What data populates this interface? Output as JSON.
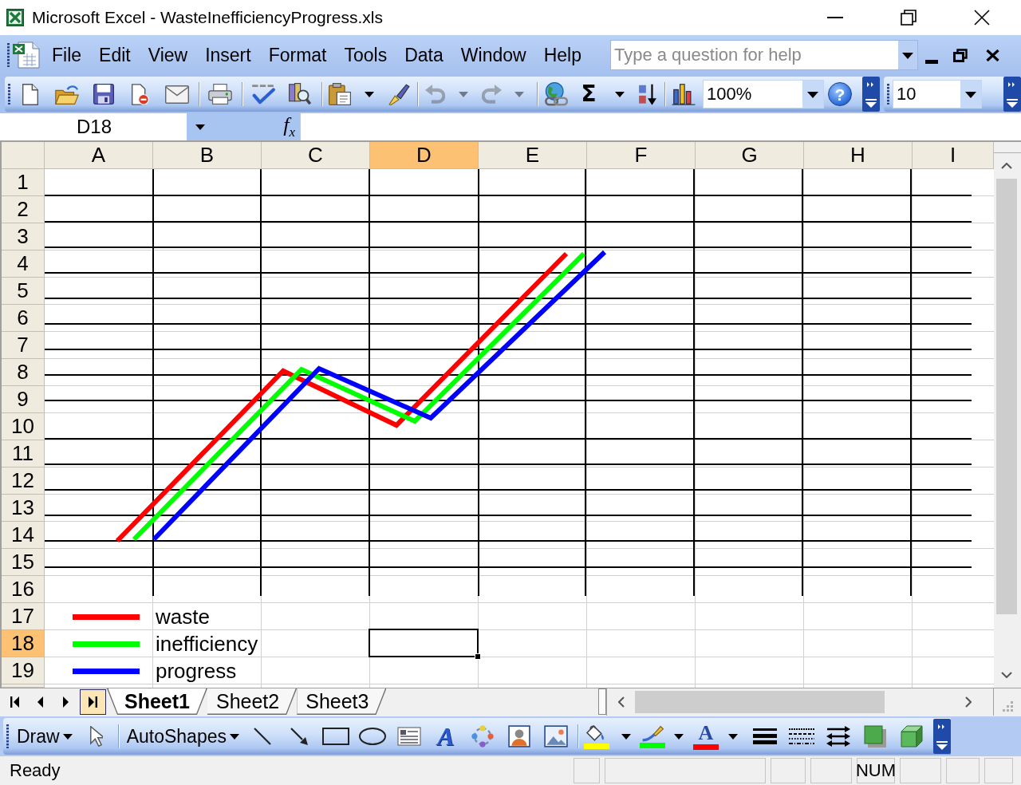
{
  "window": {
    "title": "Microsoft Excel - WasteInefficiencyProgress.xls"
  },
  "menu_bar": {
    "items": [
      {
        "label": "File"
      },
      {
        "label": "Edit"
      },
      {
        "label": "View"
      },
      {
        "label": "Insert"
      },
      {
        "label": "Format"
      },
      {
        "label": "Tools"
      },
      {
        "label": "Data"
      },
      {
        "label": "Window"
      },
      {
        "label": "Help"
      }
    ],
    "help_search": {
      "placeholder": "Type a question for help"
    }
  },
  "standard_toolbar": {
    "groups": [
      [
        {
          "kind": "new",
          "disabled": false
        },
        {
          "kind": "open",
          "disabled": false
        },
        {
          "kind": "save",
          "disabled": false
        },
        {
          "kind": "permission",
          "disabled": false
        },
        {
          "kind": "email",
          "disabled": false
        }
      ],
      [
        {
          "kind": "print",
          "disabled": false
        }
      ],
      [
        {
          "kind": "spelling",
          "disabled": false
        },
        {
          "kind": "research",
          "disabled": false
        }
      ],
      [
        {
          "kind": "paste",
          "disabled": false
        },
        {
          "kind": "dropdown",
          "disabled": false
        },
        {
          "kind": "format_painter",
          "disabled": false
        }
      ],
      [
        {
          "kind": "undo",
          "disabled": true
        },
        {
          "kind": "dropdown",
          "disabled": true
        },
        {
          "kind": "redo",
          "disabled": true
        },
        {
          "kind": "dropdown",
          "disabled": true
        }
      ],
      [
        {
          "kind": "hyperlink",
          "disabled": false
        },
        {
          "kind": "autosum",
          "glyph": "Σ",
          "disabled": false
        },
        {
          "kind": "dropdown",
          "disabled": false
        },
        {
          "kind": "sort_ascending",
          "disabled": false
        }
      ],
      [
        {
          "kind": "chart",
          "disabled": false
        },
        {
          "kind": "combo",
          "value": "100%",
          "disabled": false
        },
        {
          "kind": "help",
          "glyph": "?",
          "disabled": false
        },
        {
          "kind": "options",
          "disabled": false
        }
      ]
    ]
  },
  "formatting_toolbar": {
    "groups": [
      [
        {
          "kind": "combo",
          "value": "10",
          "disabled": false
        },
        {
          "kind": "options",
          "disabled": false
        }
      ]
    ]
  },
  "formula_bar": {
    "name_box": "D18",
    "function_button": "f$_{x}$"
  },
  "sheet": {
    "columns": [
      {
        "label": "A",
        "selected": false
      },
      {
        "label": "B",
        "selected": false
      },
      {
        "label": "C",
        "selected": false
      },
      {
        "label": "D",
        "selected": true
      },
      {
        "label": "E",
        "selected": false
      },
      {
        "label": "F",
        "selected": false
      },
      {
        "label": "G",
        "selected": false
      },
      {
        "label": "H",
        "selected": false
      },
      {
        "label": "I",
        "selected": false
      }
    ],
    "rows": [
      {
        "label": "1",
        "selected": false
      },
      {
        "label": "2",
        "selected": false
      },
      {
        "label": "3",
        "selected": false
      },
      {
        "label": "4",
        "selected": false
      },
      {
        "label": "5",
        "selected": false
      },
      {
        "label": "6",
        "selected": false
      },
      {
        "label": "7",
        "selected": false
      },
      {
        "label": "8",
        "selected": false
      },
      {
        "label": "9",
        "selected": false
      },
      {
        "label": "10",
        "selected": false
      },
      {
        "label": "11",
        "selected": false
      },
      {
        "label": "12",
        "selected": false
      },
      {
        "label": "13",
        "selected": false
      },
      {
        "label": "14",
        "selected": false
      },
      {
        "label": "15",
        "selected": false
      },
      {
        "label": "16",
        "selected": false
      },
      {
        "label": "17",
        "selected": false
      },
      {
        "label": "18",
        "selected": true
      },
      {
        "label": "19",
        "selected": false
      }
    ],
    "drawing": {
      "series": [
        {
          "name": "waste",
          "color": "#ff0000"
        },
        {
          "name": "inefficiency",
          "color": "#00ff00"
        },
        {
          "name": "progress",
          "color": "#0000ff"
        }
      ]
    }
  },
  "sheet_tabs": {
    "navigation": [
      {
        "kind": "first",
        "hovered": false
      },
      {
        "kind": "previous",
        "hovered": false
      },
      {
        "kind": "next",
        "hovered": false
      },
      {
        "kind": "last",
        "hovered": true
      }
    ],
    "tabs": [
      {
        "label": "Sheet1",
        "selected": true
      },
      {
        "label": "Sheet2",
        "selected": false
      },
      {
        "label": "Sheet3",
        "selected": false
      }
    ]
  },
  "drawing_toolbar": {
    "groups": [
      [
        {
          "kind": "menu",
          "label": "Draw"
        },
        {
          "kind": "select_objects"
        }
      ],
      [
        {
          "kind": "menu",
          "label": "AutoShapes"
        },
        {
          "kind": "line"
        },
        {
          "kind": "arrow"
        },
        {
          "kind": "rectangle"
        },
        {
          "kind": "oval"
        },
        {
          "kind": "text_box"
        },
        {
          "kind": "wordart",
          "glyph": "A"
        },
        {
          "kind": "diagram"
        },
        {
          "kind": "clip_art"
        },
        {
          "kind": "picture"
        }
      ],
      [
        {
          "kind": "fill_color",
          "color": "#ffff00"
        },
        {
          "kind": "dropdown"
        },
        {
          "kind": "line_color",
          "color": "#00ff00"
        },
        {
          "kind": "dropdown"
        },
        {
          "kind": "font_color",
          "glyph": "A",
          "color": "#ff0000"
        },
        {
          "kind": "dropdown"
        },
        {
          "kind": "line_style"
        },
        {
          "kind": "dash_style"
        },
        {
          "kind": "arrow_style"
        },
        {
          "kind": "shadow"
        },
        {
          "kind": "three_d"
        },
        {
          "kind": "options"
        }
      ]
    ]
  },
  "status_bar": {
    "message": "Ready",
    "panels": [
      {
        "kind": "empty"
      },
      {
        "kind": "empty"
      },
      {
        "kind": "empty"
      },
      {
        "kind": "empty"
      },
      {
        "kind": "indicator",
        "label": "NUM"
      },
      {
        "kind": "empty"
      },
      {
        "kind": "empty"
      },
      {
        "kind": "empty"
      }
    ]
  }
}
